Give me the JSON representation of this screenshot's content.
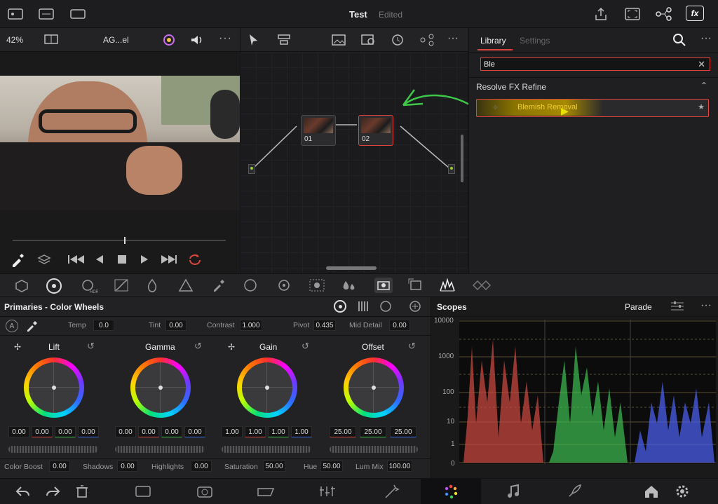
{
  "app": {
    "project_title": "Test",
    "project_status": "Edited"
  },
  "viewer_bar": {
    "zoom": "42%",
    "clip_name": "AG...el"
  },
  "library": {
    "tabs": [
      {
        "label": "Library",
        "active": true
      },
      {
        "label": "Settings",
        "active": false
      }
    ],
    "search_value": "Ble",
    "section_title": "Resolve FX Refine",
    "result_label": "Blemish Removal"
  },
  "nodes": {
    "node1_label": "01",
    "node2_label": "02"
  },
  "primaries": {
    "title": "Primaries - Color Wheels",
    "badge": "A",
    "temp_label": "Temp",
    "temp_value": "0.0",
    "tint_label": "Tint",
    "tint_value": "0.00",
    "contrast_label": "Contrast",
    "contrast_value": "1.000",
    "pivot_label": "Pivot",
    "pivot_value": "0.435",
    "middetail_label": "Mid Detail",
    "middetail_value": "0.00",
    "wheels": [
      {
        "name": "Lift",
        "values": [
          "0.00",
          "0.00",
          "0.00",
          "0.00"
        ]
      },
      {
        "name": "Gamma",
        "values": [
          "0.00",
          "0.00",
          "0.00",
          "0.00"
        ]
      },
      {
        "name": "Gain",
        "values": [
          "1.00",
          "1.00",
          "1.00",
          "1.00"
        ]
      },
      {
        "name": "Offset",
        "values": [
          "25.00",
          "25.00",
          "25.00"
        ]
      }
    ],
    "colorboost_label": "Color Boost",
    "colorboost_value": "0.00",
    "shadows_label": "Shadows",
    "shadows_value": "0.00",
    "highlights_label": "Highlights",
    "highlights_value": "0.00",
    "saturation_label": "Saturation",
    "saturation_value": "50.00",
    "hue_label": "Hue",
    "hue_value": "50.00",
    "lummix_label": "Lum Mix",
    "lummix_value": "100.00"
  },
  "scopes": {
    "title": "Scopes",
    "mode": "Parade",
    "scale": [
      "10000",
      "1000",
      "100",
      "10",
      "1",
      "0"
    ]
  },
  "colors": {
    "accent_red": "#e0443c",
    "node_green": "#9acd32",
    "annotation_green": "#3ec84a",
    "highlight_yellow": "#d9b400"
  }
}
